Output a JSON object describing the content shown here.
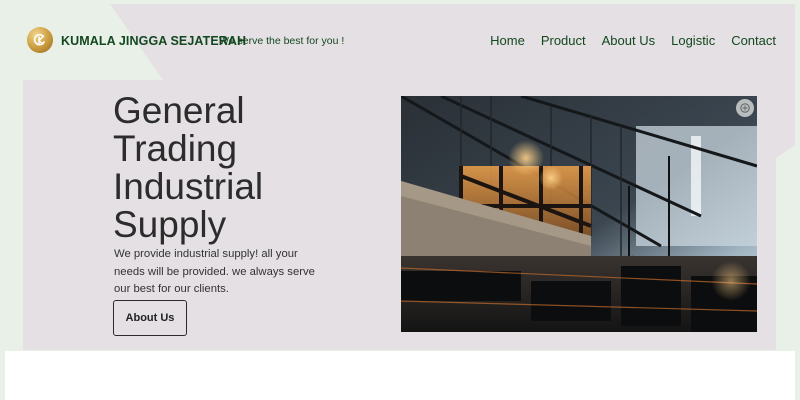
{
  "header": {
    "brand_name": "KUMALA JINGGA SEJATERAH",
    "tagline": "We serve the best for you !",
    "logo_icon": "ks-monogram-icon",
    "nav": [
      {
        "label": "Home"
      },
      {
        "label": "Product"
      },
      {
        "label": "About Us"
      },
      {
        "label": "Logistic"
      },
      {
        "label": "Contact"
      }
    ]
  },
  "hero": {
    "title_lines": [
      "General",
      "Trading",
      "Industrial",
      "Supply"
    ],
    "description": "We provide industrial supply! all your needs will be provided. we always serve our best for our clients.",
    "button_label": "About Us",
    "image_icon": "zoom-icon"
  },
  "colors": {
    "brand_green": "#13471f",
    "panel": "#e4e0e4",
    "page_bg": "#e9f0e8",
    "text_dark": "#2c2c2c"
  }
}
